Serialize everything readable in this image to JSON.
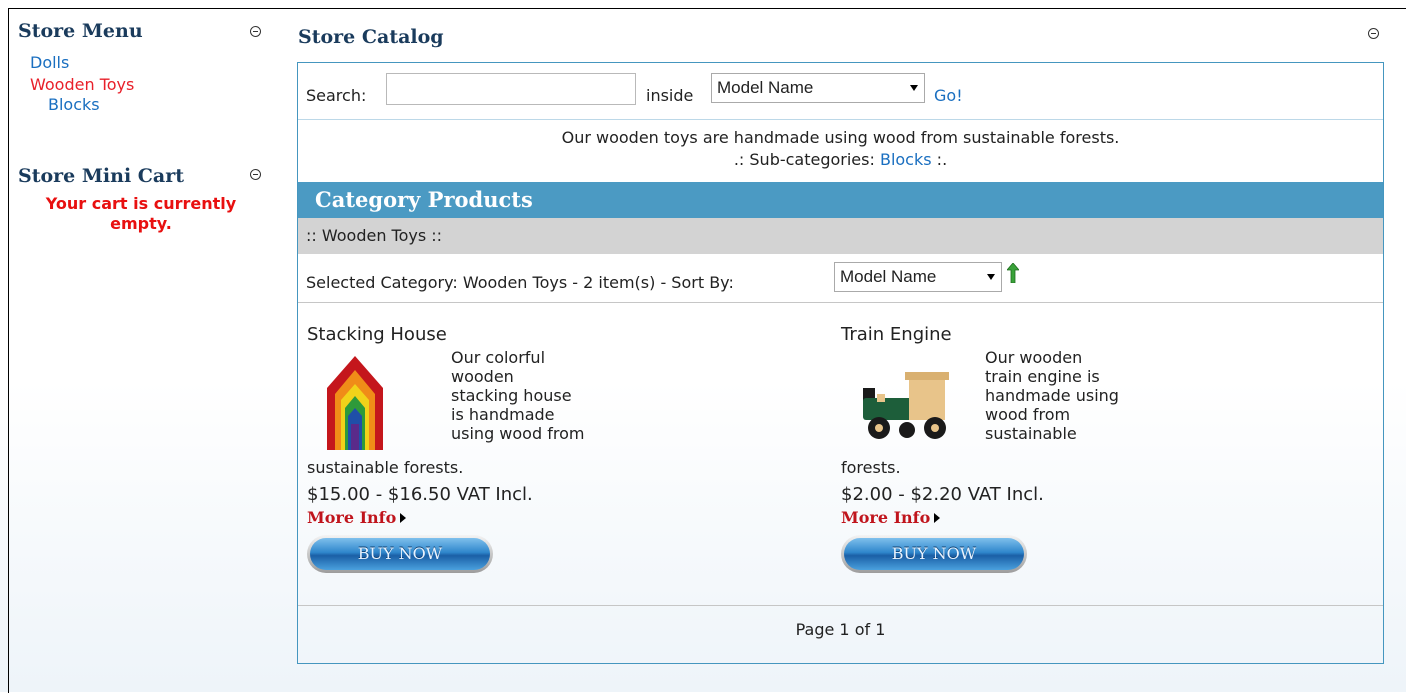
{
  "store_menu": {
    "title": "Store Menu",
    "items": [
      {
        "label": "Dolls",
        "state": "normal"
      },
      {
        "label": "Wooden Toys",
        "state": "active"
      },
      {
        "label": "Blocks",
        "state": "sub"
      }
    ]
  },
  "mini_cart": {
    "title": "Store Mini Cart",
    "empty_message_line1": "Your cart is currently",
    "empty_message_line2": "empty."
  },
  "catalog": {
    "title": "Store Catalog",
    "search": {
      "label": "Search:",
      "value": "",
      "inside_label": "inside",
      "field_select": "Model Name",
      "go_label": "Go!"
    },
    "description": "Our wooden toys are handmade using wood from sustainable forests.",
    "subcat_prefix": ".: Sub-categories:",
    "subcat_link": "Blocks",
    "subcat_suffix": ":.",
    "products_header": "Category Products",
    "path": ":: Wooden Toys ::",
    "selected_text": "Selected Category: Wooden Toys - 2 item(s) - Sort By:",
    "sort_select": "Model Name",
    "products": [
      {
        "name": "Stacking House",
        "desc_lines": [
          "Our colorful",
          "wooden",
          "stacking house",
          "is handmade",
          "using wood from"
        ],
        "desc_tail": "sustainable forests.",
        "price": "$15.00 - $16.50 VAT Incl.",
        "more_info": "More Info",
        "buy_label": "BUY NOW"
      },
      {
        "name": "Train Engine",
        "desc_lines": [
          "Our wooden",
          "train engine is",
          "handmade using",
          "wood from",
          "sustainable"
        ],
        "desc_tail": "forests.",
        "price": "$2.00 - $2.20 VAT Incl.",
        "more_info": "More Info",
        "buy_label": "BUY NOW"
      }
    ],
    "pager": "Page 1 of 1"
  },
  "colors": {
    "accent_blue": "#4b9ac3",
    "link": "#1a6fc0",
    "active_link": "#e8202a",
    "cart_empty": "#e81010",
    "more_info": "#c0141c"
  }
}
